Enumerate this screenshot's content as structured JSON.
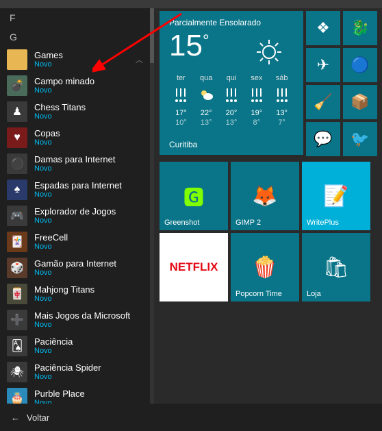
{
  "letters": {
    "f": "F",
    "g": "G"
  },
  "folder": {
    "name": "Games",
    "sub": "Novo"
  },
  "apps": [
    {
      "title": "Campo minado",
      "sub": "Novo",
      "bg": "#4a6b5a",
      "emoji": "💣"
    },
    {
      "title": "Chess Titans",
      "sub": "Novo",
      "bg": "#3a3a3a",
      "emoji": "♟"
    },
    {
      "title": "Copas",
      "sub": "Novo",
      "bg": "#7a1b1b",
      "emoji": "♥"
    },
    {
      "title": "Damas para Internet",
      "sub": "Novo",
      "bg": "#3a3a3a",
      "emoji": "⚫"
    },
    {
      "title": "Espadas para Internet",
      "sub": "Novo",
      "bg": "#2a3a6a",
      "emoji": "♠"
    },
    {
      "title": "Explorador de Jogos",
      "sub": "Novo",
      "bg": "#3a3a3a",
      "emoji": "🎮"
    },
    {
      "title": "FreeCell",
      "sub": "Novo",
      "bg": "#6a3a1a",
      "emoji": "🃏"
    },
    {
      "title": "Gamão para Internet",
      "sub": "Novo",
      "bg": "#5a3a2a",
      "emoji": "🎲"
    },
    {
      "title": "Mahjong Titans",
      "sub": "Novo",
      "bg": "#4a4a3a",
      "emoji": "🀄"
    },
    {
      "title": "Mais Jogos da Microsoft",
      "sub": "Novo",
      "bg": "#3a3a3a",
      "emoji": "➕"
    },
    {
      "title": "Paciência",
      "sub": "Novo",
      "bg": "#3a3a3a",
      "emoji": "🂡"
    },
    {
      "title": "Paciência Spider",
      "sub": "Novo",
      "bg": "#3a3a3a",
      "emoji": "🕷"
    },
    {
      "title": "Purble Place",
      "sub": "Novo",
      "bg": "#2a8aba",
      "emoji": "🎂"
    }
  ],
  "weather": {
    "condition": "Parcialmente Ensolarado",
    "temp": "15",
    "degree": "°",
    "city": "Curitiba",
    "forecast": [
      {
        "d": "ter",
        "hi": "17°",
        "lo": "10°",
        "icon": "rain"
      },
      {
        "d": "qua",
        "hi": "22°",
        "lo": "13°",
        "icon": "partly"
      },
      {
        "d": "qui",
        "hi": "20°",
        "lo": "13°",
        "icon": "rain"
      },
      {
        "d": "sex",
        "hi": "19°",
        "lo": "8°",
        "icon": "rain"
      },
      {
        "d": "sáb",
        "hi": "13°",
        "lo": "7°",
        "icon": "rain"
      }
    ]
  },
  "small_tiles": [
    {
      "name": "steam",
      "emoji": "❖",
      "bg": "#0a7589"
    },
    {
      "name": "app2",
      "emoji": "🐉",
      "bg": "#0a7589"
    },
    {
      "name": "paper-plane",
      "emoji": "✈",
      "bg": "#0a7589"
    },
    {
      "name": "qbittorrent",
      "emoji": "🔵",
      "bg": "#0a7589"
    },
    {
      "name": "ccleaner",
      "emoji": "🧹",
      "bg": "#0a7589"
    },
    {
      "name": "app6",
      "emoji": "📦",
      "bg": "#0a7589"
    },
    {
      "name": "skype",
      "emoji": "💬",
      "bg": "#0a7589"
    },
    {
      "name": "app8",
      "emoji": "🐦",
      "bg": "#0a7589"
    }
  ],
  "medium_tiles": [
    {
      "label": "Greenshot",
      "bg": "#0a7589",
      "icon": "🅶",
      "color": "#7fff00"
    },
    {
      "label": "GIMP 2",
      "bg": "#0a7589",
      "icon": "🦊",
      "color": "#8a6a4a"
    },
    {
      "label": "WritePlus",
      "bg": "#00b0d8",
      "icon": "📝",
      "color": "#fff"
    },
    {
      "label": "",
      "bg": "#ffffff",
      "icon": "NETFLIX",
      "color": "#e50914",
      "netflix": true
    },
    {
      "label": "Popcorn Time",
      "bg": "#0a7589",
      "icon": "🍿",
      "color": "#d4a050"
    },
    {
      "label": "Loja",
      "bg": "#0a7589",
      "icon": "🛍",
      "color": "#fff"
    }
  ],
  "back": "Voltar"
}
